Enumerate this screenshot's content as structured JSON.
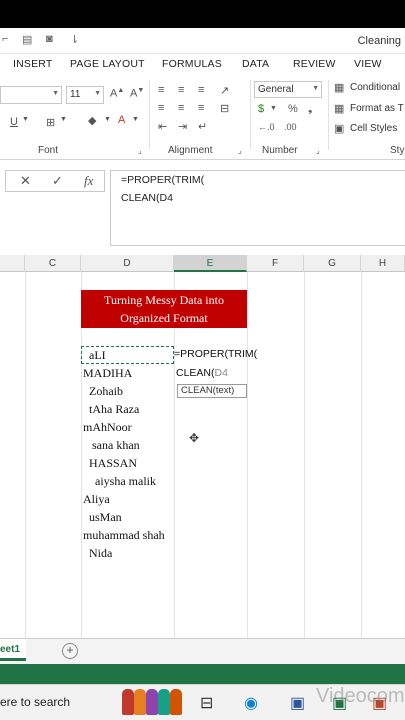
{
  "window": {
    "title": "Cleaning"
  },
  "ribbon_tabs": [
    "INSERT",
    "PAGE LAYOUT",
    "FORMULAS",
    "DATA",
    "REVIEW",
    "VIEW"
  ],
  "ribbon": {
    "font_size": "11",
    "number_format": "General",
    "conditional": "Conditional",
    "format_as": "Format as T",
    "cell_styles": "Cell Styles",
    "groups": {
      "font": "Font",
      "alignment": "Alignment",
      "number": "Number",
      "styles": "Styl"
    },
    "percent": "%",
    "decimals_inc": "←.0",
    "decimals_dec": ".00",
    "currency": "$"
  },
  "formula_bar": {
    "cancel": "✕",
    "enter": "✓",
    "fx": "fx",
    "line1": "=PROPER(TRIM(",
    "line2": "CLEAN(D4"
  },
  "columns": [
    "C",
    "D",
    "E",
    "F",
    "G",
    "H"
  ],
  "active_column": "E",
  "banner": {
    "line1": "Turning Messy Data into",
    "line2": "Organized Format"
  },
  "names": [
    "  aLI",
    "MADIHA",
    "  Zohaib",
    "  tAha Raza",
    "mAhNoor",
    "   sana khan",
    "  HASSAN",
    "    aiysha malik",
    "Aliya",
    "  usMan",
    "muhammad shah",
    "  Nida"
  ],
  "edit_cell": {
    "line1": "=PROPER(TRIM(",
    "line2_func": "CLEAN(",
    "line2_ref": "D4"
  },
  "tooltip": "CLEAN(text)",
  "sheet_tab": "eet1",
  "taskbar": {
    "search": "ere to search",
    "watermark": "Videocom"
  }
}
